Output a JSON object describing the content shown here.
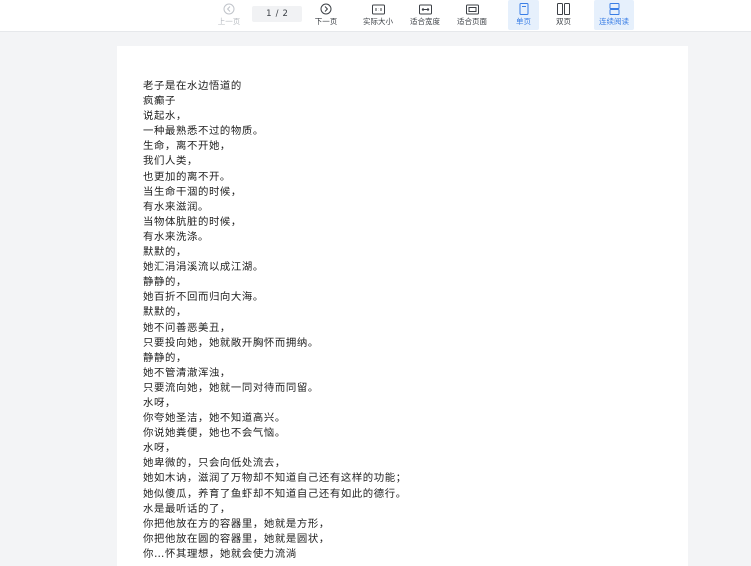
{
  "toolbar": {
    "prev_label": "上一页",
    "page_current": "1",
    "page_total": "2",
    "next_label": "下一页",
    "actual_size_label": "实际大小",
    "fit_width_label": "适合宽度",
    "fit_page_label": "适合页面",
    "single_page_label": "单页",
    "double_page_label": "双页",
    "continuous_label": "连续阅读",
    "accent_color": "#3a7ee6",
    "active_bg": "#e6f0fc",
    "prev_icon": "chevron-left-circle-icon",
    "next_icon": "chevron-right-circle-icon",
    "actual_size_icon": "one-to-one-icon",
    "fit_width_icon": "fit-width-icon",
    "fit_page_icon": "fit-page-icon",
    "single_page_icon": "single-page-icon",
    "double_page_icon": "double-page-icon",
    "continuous_icon": "continuous-scroll-icon"
  },
  "document": {
    "lines": [
      "老子是在水边悟道的",
      "疯癫子",
      "说起水，",
      "一种最熟悉不过的物质。",
      "生命，离不开她，",
      "我们人类，",
      "也更加的离不开。",
      "当生命干涸的时候，",
      "有水来滋润。",
      "当物体肮脏的时候，",
      "有水来洗涤。",
      "默默的，",
      "她汇涓涓溪流以成江湖。",
      "静静的，",
      "她百折不回而归向大海。",
      "默默的，",
      "她不问善恶美丑，",
      "只要投向她，她就敞开胸怀而拥纳。",
      "静静的，",
      "她不管清澈浑浊，",
      "只要流向她，她就一同对待而同留。",
      "水呀，",
      "你夸她圣洁，她不知道高兴。",
      "你说她粪便，她也不会气恼。",
      "水呀，",
      "她卑微的，只会向低处流去，",
      "她如木讷，滋润了万物却不知道自己还有这样的功能；",
      "她似傻瓜，养育了鱼虾却不知道自己还有如此的德行。",
      "水是最听话的了，",
      "你把他放在方的容器里，她就是方形，",
      "你把他放在圆的容器里，她就是圆状，",
      "你…怀其理想，她就会使力流淌"
    ]
  }
}
